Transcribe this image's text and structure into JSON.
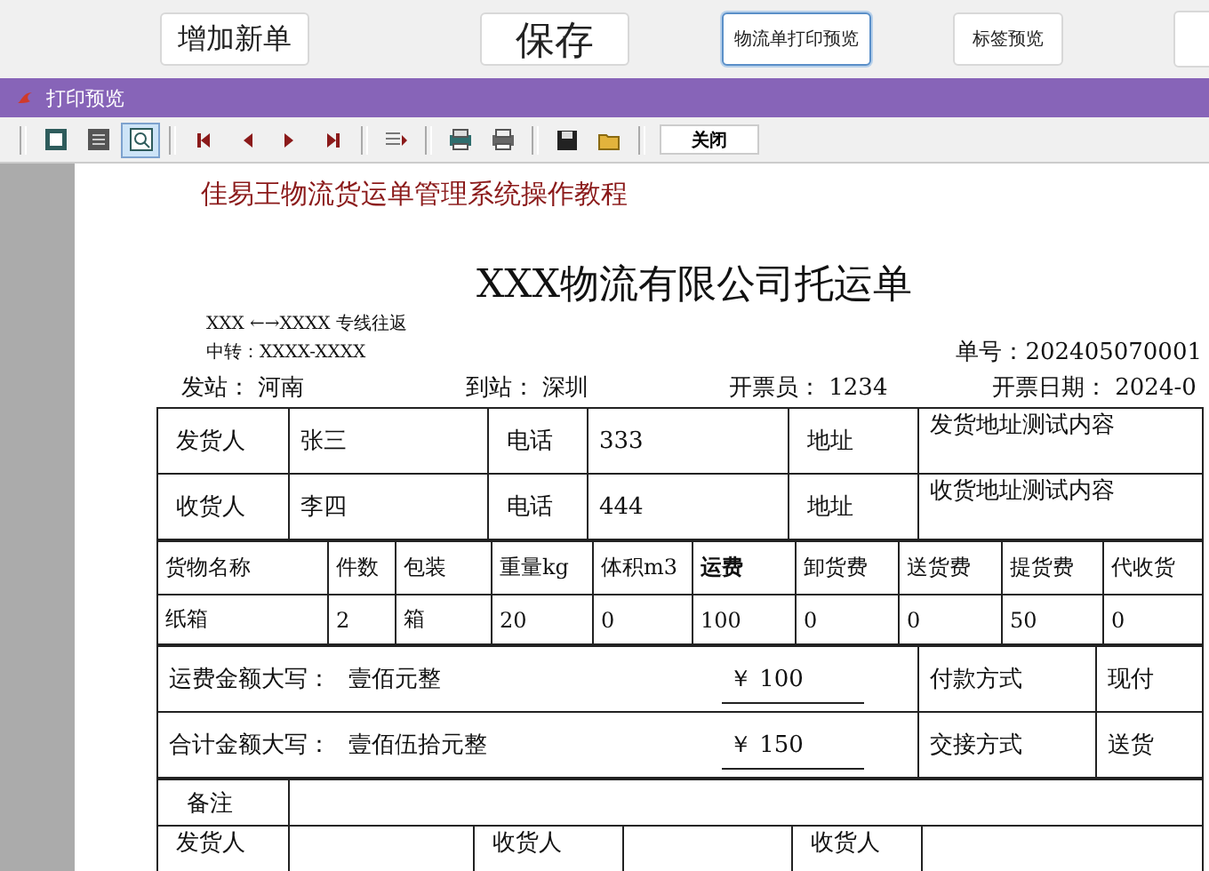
{
  "top_buttons": [
    {
      "label": "增加新单",
      "focused": false
    },
    {
      "label": "保存",
      "focused": false
    },
    {
      "label": "物流单打印预览",
      "focused": true
    },
    {
      "label": "标签预览",
      "focused": false
    }
  ],
  "window": {
    "title": "打印预览"
  },
  "toolbar": {
    "tools": [
      {
        "kind": "one-page",
        "selected": false
      },
      {
        "kind": "multi-page",
        "selected": false
      },
      {
        "kind": "zoom",
        "selected": true
      },
      {
        "kind": "first",
        "selected": false
      },
      {
        "kind": "prev",
        "selected": false
      },
      {
        "kind": "next",
        "selected": false
      },
      {
        "kind": "last",
        "selected": false
      },
      {
        "kind": "goto",
        "selected": false
      },
      {
        "kind": "print-setup",
        "selected": false
      },
      {
        "kind": "print",
        "selected": false
      },
      {
        "kind": "save",
        "selected": false
      },
      {
        "kind": "open",
        "selected": false
      }
    ],
    "close_button": "关闭"
  },
  "document": {
    "banner": "佳易王物流货运单管理系统操作教程",
    "title": "XXX物流有限公司托运单",
    "route": "XXX ←→XXXX 专线往返",
    "transfer": "中转：XXXX-XXXX",
    "order_no": "单号：202405070001",
    "info": [
      {
        "label": "发站：",
        "value": "河南"
      },
      {
        "label": "到站：",
        "value": "深圳"
      },
      {
        "label": "开票员：",
        "value": "1234"
      },
      {
        "label": "开票日期：",
        "value": "2024-0"
      }
    ],
    "parties": [
      [
        "发货人",
        "张三",
        "电话",
        "333",
        "地址",
        "发货地址测试内容"
      ],
      [
        "收货人",
        "李四",
        "电话",
        "444",
        "地址",
        "收货地址测试内容"
      ]
    ],
    "goods_columns": [
      {
        "label": "货物名称",
        "bold": false
      },
      {
        "label": "件数",
        "bold": false
      },
      {
        "label": "包装",
        "bold": false
      },
      {
        "label": "重量kg",
        "bold": false
      },
      {
        "label": "体积m3",
        "bold": false
      },
      {
        "label": "运费",
        "bold": true
      },
      {
        "label": "卸货费",
        "bold": false
      },
      {
        "label": "送货费",
        "bold": false
      },
      {
        "label": "提货费",
        "bold": false
      },
      {
        "label": "代收货",
        "bold": false
      }
    ],
    "goods_rows": [
      [
        "纸箱",
        "2",
        "箱",
        "20",
        "0",
        "100",
        "0",
        "0",
        "50",
        "0"
      ]
    ],
    "amounts": [
      {
        "label": "运费金额大写：",
        "words": "壹佰元整",
        "amount": "￥ 100",
        "term": "付款方式",
        "term_value": "现付"
      },
      {
        "label": "合计金额大写：",
        "words": "壹佰伍拾元整",
        "amount": "￥ 150",
        "term": "交接方式",
        "term_value": "送货"
      }
    ],
    "remarks_label": "备注",
    "signatures": [
      "发货人",
      "收货人",
      "收货人"
    ]
  }
}
